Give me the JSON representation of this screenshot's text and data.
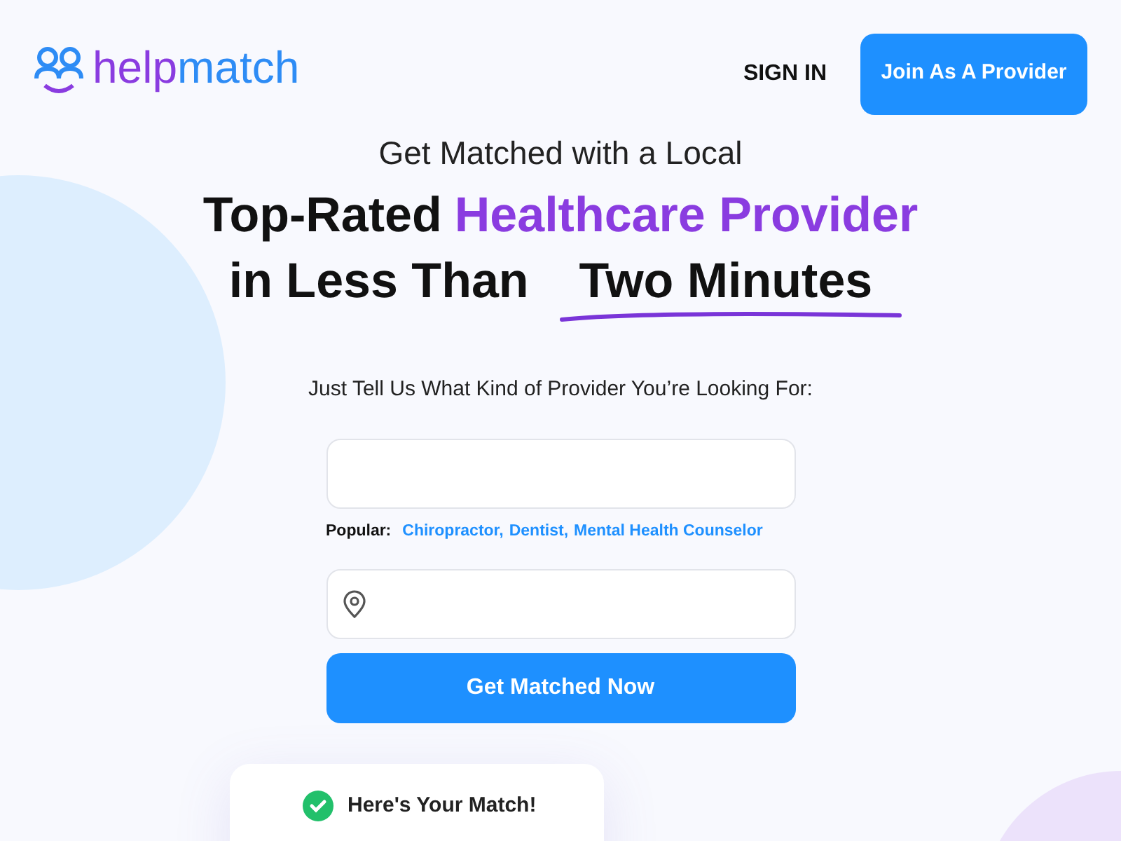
{
  "header": {
    "logo": {
      "first": "help",
      "second": "match"
    },
    "sign_in": "SIGN IN",
    "join_button": "Join As A Provider"
  },
  "hero": {
    "kicker": "Get Matched with a Local",
    "line1": {
      "plain": "Top-Rated",
      "highlight": "Healthcare Provider"
    },
    "line2": {
      "plain": "in Less Than",
      "underlined": "Two Minutes"
    }
  },
  "form": {
    "prompt": "Just Tell Us What Kind of Provider You’re Looking For:",
    "popular_label": "Popular:",
    "popular_links": [
      "Chiropractor,",
      "Dentist,",
      "Mental Health Counselor"
    ],
    "submit": "Get Matched Now"
  },
  "match_card": {
    "title": "Here's Your Match!"
  }
}
